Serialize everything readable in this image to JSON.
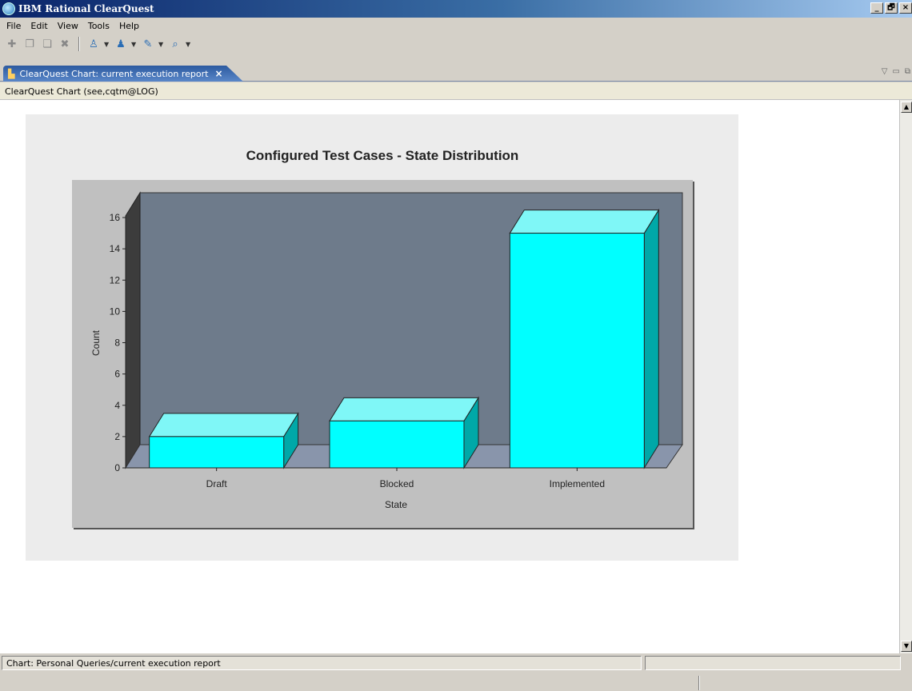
{
  "window": {
    "title": "IBM Rational ClearQuest",
    "controls": [
      "_",
      "🗗",
      "×"
    ]
  },
  "menu": [
    "File",
    "Edit",
    "View",
    "Tools",
    "Help"
  ],
  "editor_tab": {
    "label": "ClearQuest Chart: current execution report",
    "close": "×"
  },
  "editor_header": "ClearQuest Chart (see,cqtm@LOG)",
  "chart_data": {
    "type": "bar",
    "title": "Configured Test Cases - State Distribution",
    "xlabel": "State",
    "ylabel": "Count",
    "categories": [
      "Draft",
      "Blocked",
      "Implemented"
    ],
    "values": [
      2,
      3,
      15
    ],
    "ylim": [
      0,
      16
    ],
    "yticks": [
      0,
      2,
      4,
      6,
      8,
      10,
      12,
      14,
      16
    ],
    "style": "3d",
    "bar_color": "#00ffff",
    "plot_background": "#6e7b8b"
  },
  "status": {
    "left": "Chart: Personal Queries/current execution report",
    "right": ""
  }
}
